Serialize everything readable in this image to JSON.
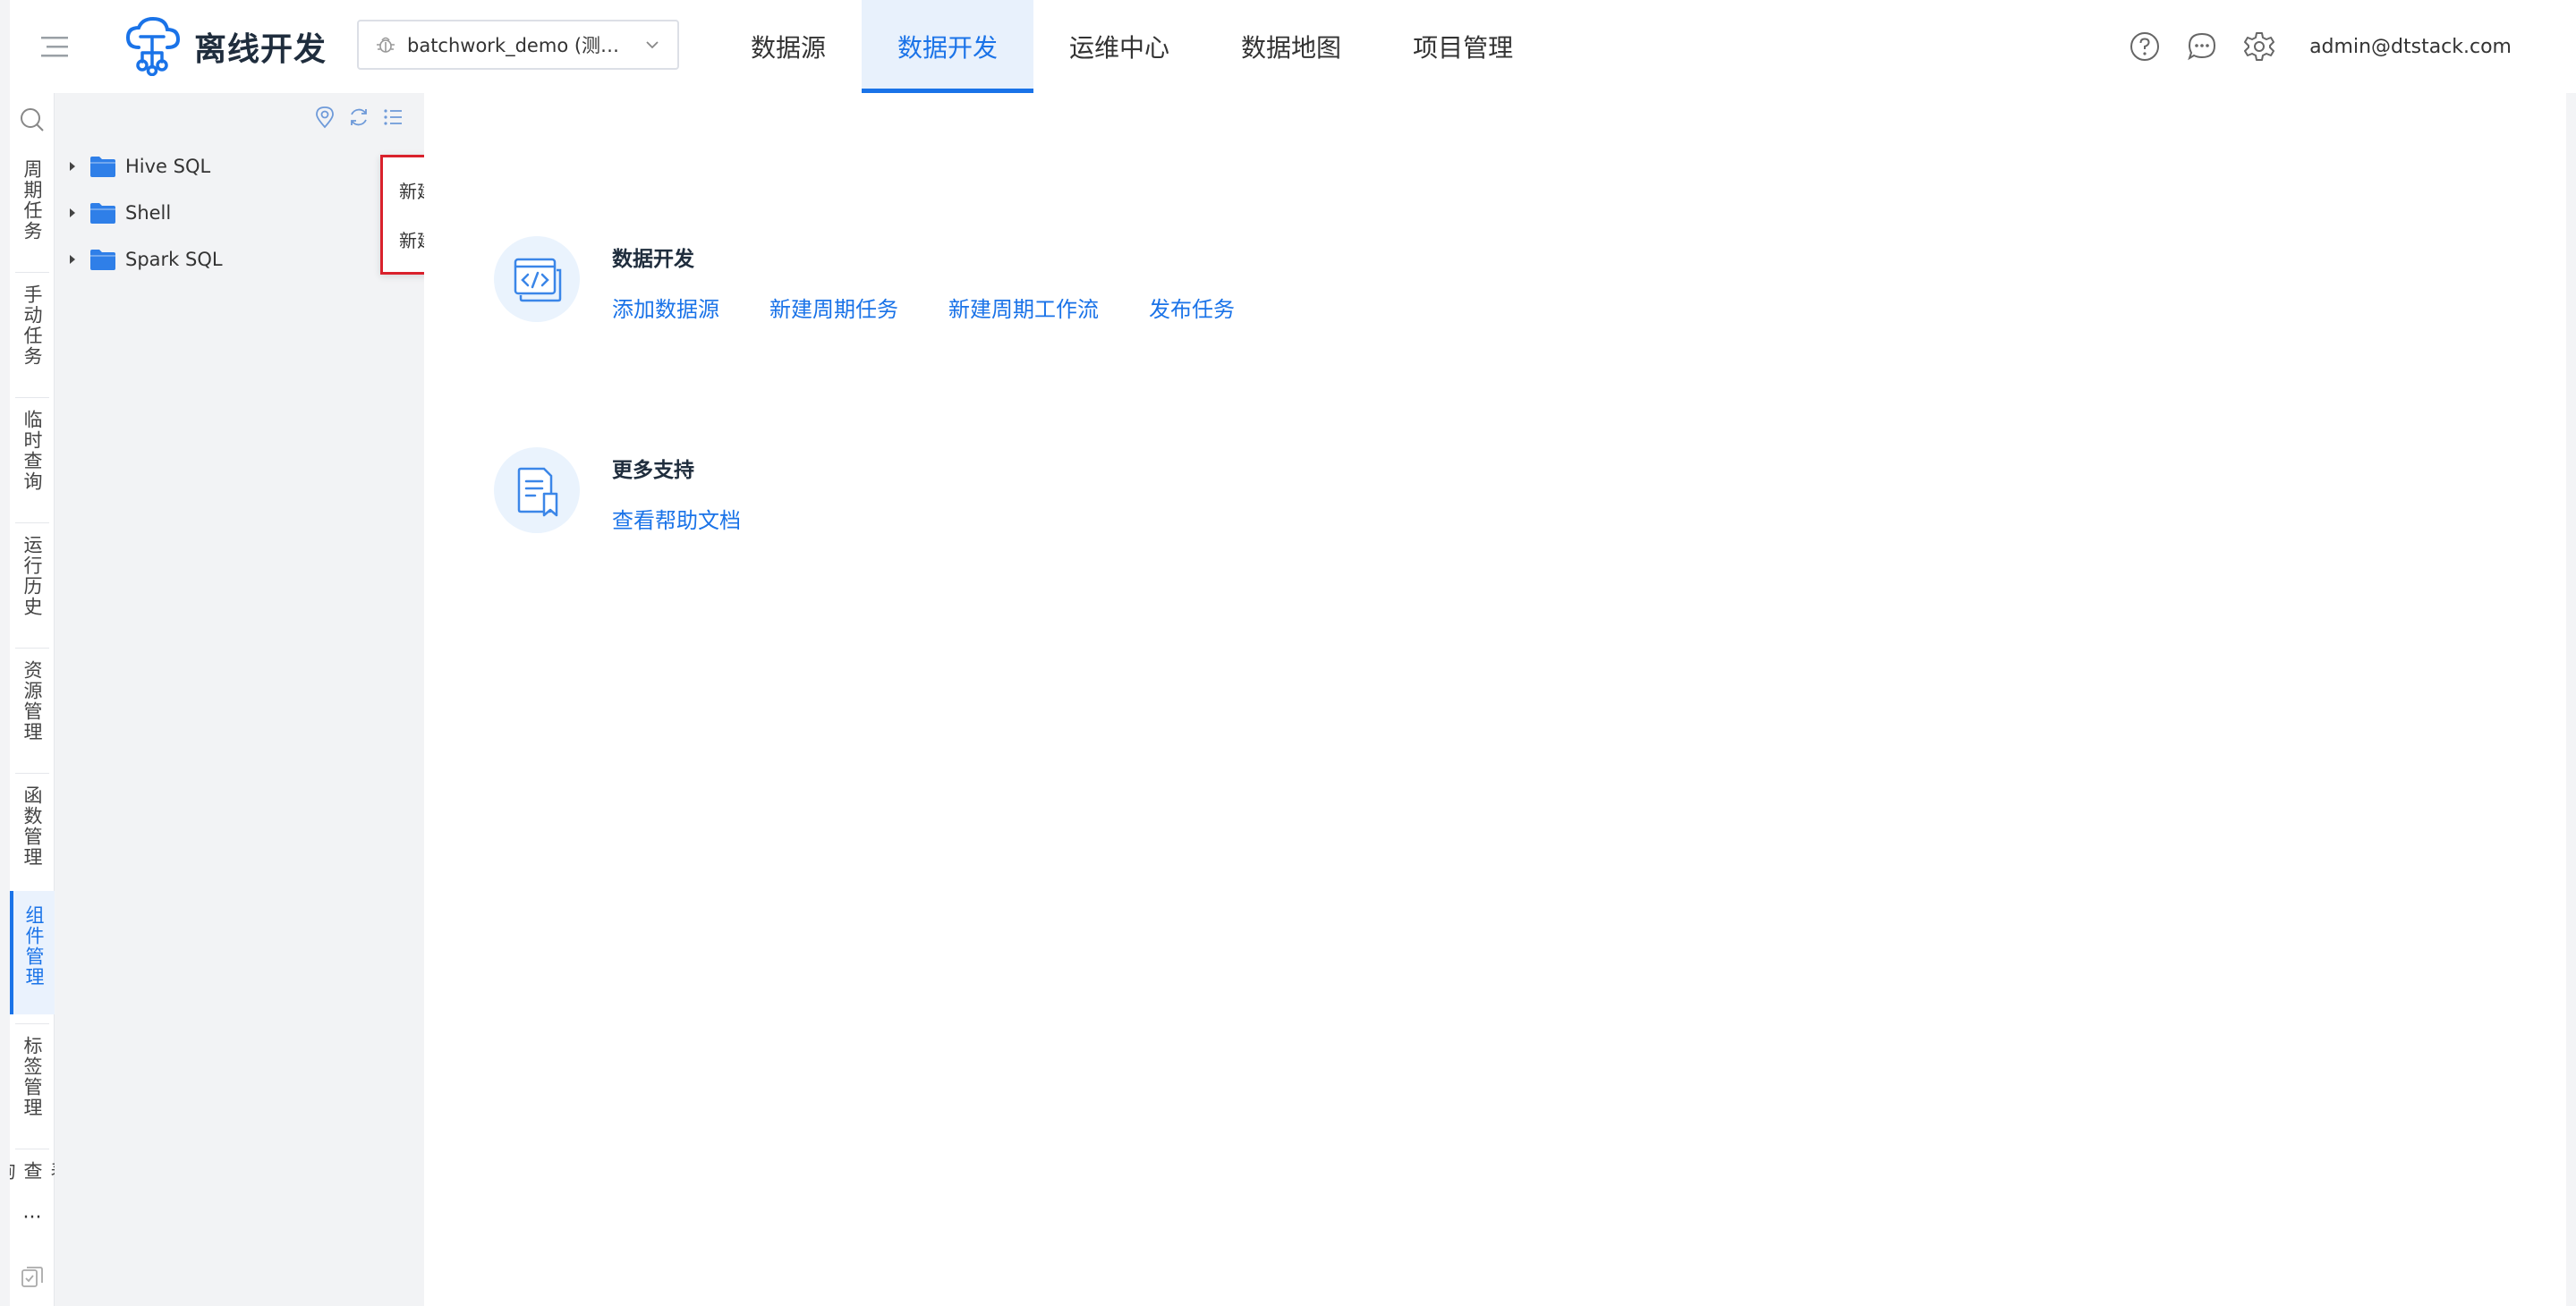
{
  "header": {
    "app_title": "离线开发",
    "project_select": "batchwork_demo (测试项...",
    "nav": [
      "数据源",
      "数据开发",
      "运维中心",
      "数据地图",
      "项目管理"
    ],
    "active_nav": 1,
    "user": "admin@dtstack.com",
    "icons": [
      "help-icon",
      "message-icon",
      "gear-icon"
    ]
  },
  "vtabs": {
    "items": [
      "周期任务",
      "手动任务",
      "临时查询",
      "运行历史",
      "资源管理",
      "函数管理",
      "组件管理",
      "标签管理",
      "表查询"
    ],
    "active": 6,
    "more": "···"
  },
  "tree": {
    "nodes": [
      "Hive SQL",
      "Shell",
      "Spark SQL"
    ]
  },
  "context_menu": {
    "items": [
      "新建组件",
      "新建文件夹"
    ]
  },
  "main": {
    "dev": {
      "title": "数据开发",
      "links": [
        "添加数据源",
        "新建周期任务",
        "新建周期工作流",
        "发布任务"
      ]
    },
    "support": {
      "title": "更多支持",
      "links": [
        "查看帮助文档"
      ]
    }
  },
  "colors": {
    "accent": "#1a73e8",
    "highlight_border": "#d9212c"
  }
}
